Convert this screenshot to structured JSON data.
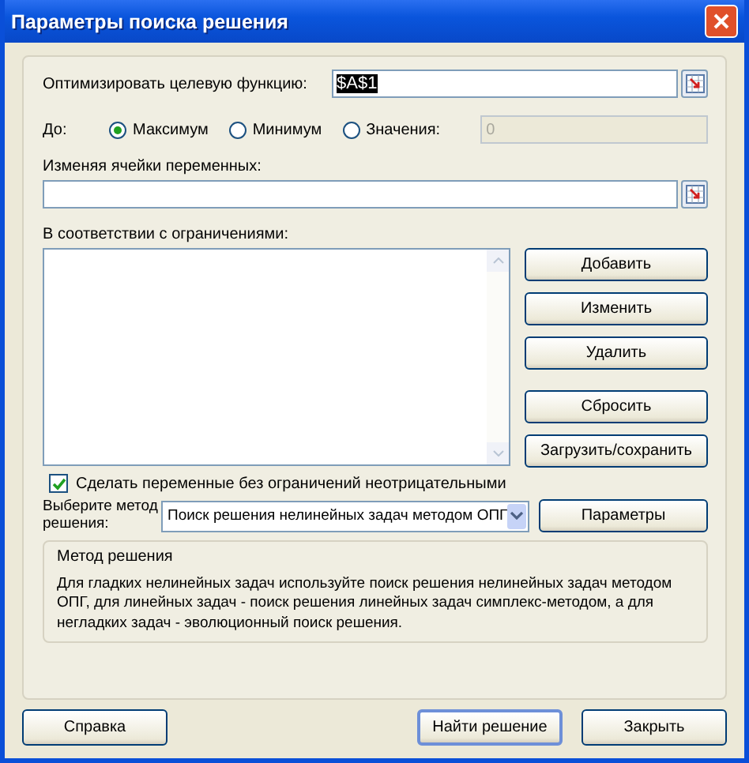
{
  "window": {
    "title": "Параметры поиска решения"
  },
  "objective": {
    "label": "Оптимизировать целевую функцию:",
    "value": "$A$1",
    "highlighted": true
  },
  "to": {
    "label": "До:",
    "options": [
      {
        "label": "Максимум",
        "selected": true
      },
      {
        "label": "Минимум",
        "selected": false
      },
      {
        "label": "Значения:",
        "selected": false
      }
    ],
    "value_field": {
      "value": "0",
      "disabled": true
    }
  },
  "variables": {
    "label": "Изменяя ячейки переменных:"
  },
  "constraints": {
    "label": "В соответствии с ограничениями:",
    "button_groups": [
      [
        "Добавить",
        "Изменить",
        "Удалить"
      ],
      [
        "Сбросить",
        "Загрузить/сохранить"
      ]
    ]
  },
  "nonnegative": {
    "label": "Сделать переменные без ограничений неотрицательными",
    "checked": true
  },
  "method": {
    "label": "Выберите метод решения:",
    "value": "Поиск решения нелинейных задач методом ОПГ",
    "button": "Параметры"
  },
  "method_group": {
    "title": "Метод решения",
    "description": "Для гладких нелинейных задач используйте поиск решения нелинейных задач методом ОПГ, для линейных задач - поиск решения линейных задач симплекс-методом, а для негладких задач - эволюционный поиск решения."
  },
  "footer": {
    "button_groups": [
      [
        {
          "label": "Справка",
          "default": false
        }
      ],
      [
        {
          "label": "Найти решение",
          "default": true
        },
        {
          "label": "Закрыть",
          "default": false
        }
      ]
    ]
  }
}
